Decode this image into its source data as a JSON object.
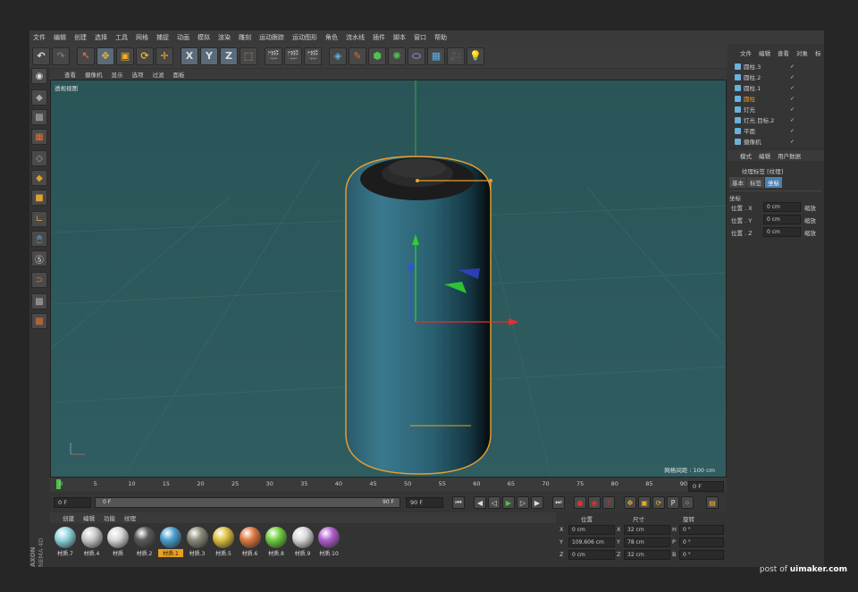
{
  "menu": [
    "文件",
    "编辑",
    "创建",
    "选择",
    "工具",
    "网格",
    "捕捉",
    "动画",
    "模拟",
    "渲染",
    "雕刻",
    "运动跟踪",
    "运动图形",
    "角色",
    "流水线",
    "插件",
    "脚本",
    "窗口",
    "帮助"
  ],
  "toolbar": {
    "undo_icon": "undo-icon",
    "redo_icon": "redo-icon",
    "x_label": "X",
    "y_label": "Y",
    "z_label": "Z"
  },
  "viewport": {
    "menu": [
      "查看",
      "摄像机",
      "显示",
      "选项",
      "过滤",
      "面板"
    ],
    "title": "透视视图",
    "grid_spacing": "网格间距 : 100 cm"
  },
  "timeline": {
    "ticks": [
      "0",
      "5",
      "10",
      "15",
      "20",
      "25",
      "30",
      "35",
      "40",
      "45",
      "50",
      "55",
      "60",
      "65",
      "70",
      "75",
      "80",
      "85",
      "90"
    ],
    "current_frame": "0 F",
    "end_frame_field": "0 F"
  },
  "transport": {
    "start": "0 F",
    "slider_left": "0 F",
    "slider_right": "90 F",
    "end": "90 F"
  },
  "materials": {
    "menu": [
      "创建",
      "编辑",
      "功能",
      "纹理"
    ],
    "items": [
      {
        "label": "材质.7",
        "color": "#8fd6e0",
        "active": false
      },
      {
        "label": "材质.4",
        "color": "#c8c8c8",
        "active": false
      },
      {
        "label": "材质",
        "color": "#d8d8d8",
        "active": false
      },
      {
        "label": "材质.2",
        "color": "#5a5a5a",
        "active": false
      },
      {
        "label": "材质.1",
        "color": "#4a9fd0",
        "active": true
      },
      {
        "label": "材质.3",
        "color": "#8a8a7a",
        "active": false
      },
      {
        "label": "材质.5",
        "color": "#e0c040",
        "active": false
      },
      {
        "label": "材质.6",
        "color": "#e07840",
        "active": false
      },
      {
        "label": "材质.8",
        "color": "#70d040",
        "active": false
      },
      {
        "label": "材质.9",
        "color": "#d8d8d8",
        "active": false
      },
      {
        "label": "材质.10",
        "color": "#b060d0",
        "active": false
      }
    ]
  },
  "coords": {
    "headers": [
      "位置",
      "尺寸",
      "旋转"
    ],
    "rows": [
      {
        "axis": "X",
        "pos": "0 cm",
        "size_axis": "X",
        "size": "32 cm",
        "rot_axis": "H",
        "rot": "0 °"
      },
      {
        "axis": "Y",
        "pos": "109.606 cm",
        "size_axis": "Y",
        "size": "78 cm",
        "rot_axis": "P",
        "rot": "0 °"
      },
      {
        "axis": "Z",
        "pos": "0 cm",
        "size_axis": "Z",
        "size": "32 cm",
        "rot_axis": "B",
        "rot": "0 °"
      }
    ]
  },
  "objects": {
    "menu": [
      "文件",
      "编辑",
      "查看",
      "对象",
      "标"
    ],
    "items": [
      {
        "name": "圆柱.3",
        "selected": false
      },
      {
        "name": "圆柱.2",
        "selected": false
      },
      {
        "name": "圆柱.1",
        "selected": false
      },
      {
        "name": "圆柱",
        "selected": true
      },
      {
        "name": "灯光",
        "selected": false
      },
      {
        "name": "灯光.目标.2",
        "selected": false
      },
      {
        "name": "平面",
        "selected": false
      },
      {
        "name": "摄像机",
        "selected": false
      }
    ]
  },
  "attributes": {
    "menu": [
      "模式",
      "编辑",
      "用户数据"
    ],
    "title": "纹理标签 [纹理]",
    "tabs": [
      "基本",
      "标签",
      "坐标"
    ],
    "active_tab": "坐标",
    "section": "坐标",
    "rows": [
      {
        "label": "位置 . X",
        "value": "0 cm",
        "right": "缩放"
      },
      {
        "label": "位置 . Y",
        "value": "0 cm",
        "right": "缩放"
      },
      {
        "label": "位置 . Z",
        "value": "0 cm",
        "right": "缩放"
      }
    ]
  },
  "brand": {
    "line1": "AXON",
    "line2": "NEMA 4D"
  },
  "watermark": {
    "prefix": "post of ",
    "site": "uimaker.com"
  }
}
